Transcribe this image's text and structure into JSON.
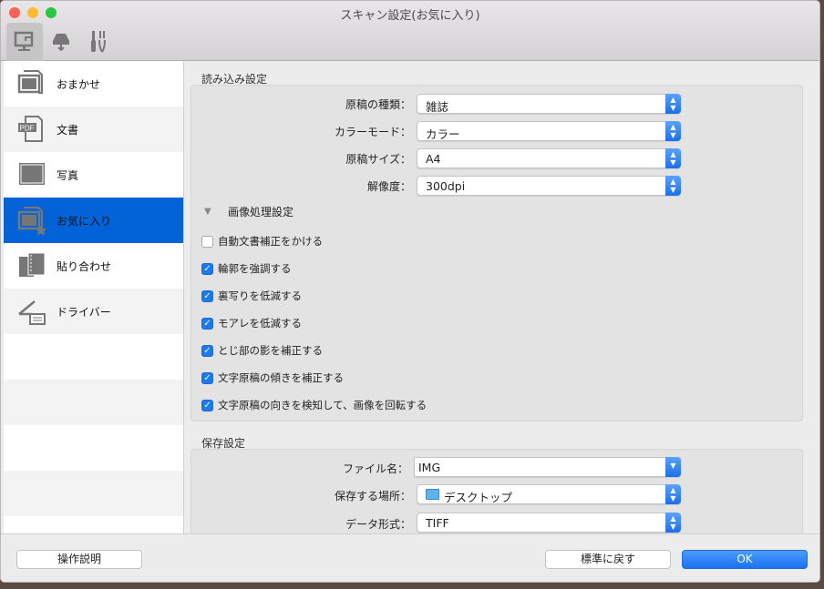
{
  "window": {
    "title": "スキャン設定(お気に入り)"
  },
  "toolbar": {
    "items": [
      "scan-from-computer",
      "scan-from-operation-panel",
      "general-settings"
    ]
  },
  "sidebar": {
    "items": [
      {
        "label": "おまかせ",
        "icon": "auto-scan-icon"
      },
      {
        "label": "文書",
        "icon": "pdf-document-icon"
      },
      {
        "label": "写真",
        "icon": "photo-icon"
      },
      {
        "label": "お気に入り",
        "icon": "favorite-icon",
        "selected": true
      },
      {
        "label": "貼り合わせ",
        "icon": "stitch-icon"
      },
      {
        "label": "ドライバー",
        "icon": "scanner-driver-icon"
      }
    ]
  },
  "scan_settings": {
    "title": "読み込み設定",
    "fields": [
      {
        "label": "原稿の種類：",
        "value": "雑誌"
      },
      {
        "label": "カラーモード：",
        "value": "カラー"
      },
      {
        "label": "原稿サイズ：",
        "value": "A4"
      },
      {
        "label": "解像度：",
        "value": "300dpi"
      }
    ],
    "image_processing": {
      "title": "画像処理設定",
      "expanded": true,
      "options": [
        {
          "label": "自動文書補正をかける",
          "checked": false
        },
        {
          "label": "輪郭を強調する",
          "checked": true
        },
        {
          "label": "裏写りを低減する",
          "checked": true
        },
        {
          "label": "モアレを低減する",
          "checked": true
        },
        {
          "label": "とじ部の影を補正する",
          "checked": true
        },
        {
          "label": "文字原稿の傾きを補正する",
          "checked": true
        },
        {
          "label": "文字原稿の向きを検知して、画像を回転する",
          "checked": true
        }
      ]
    }
  },
  "save_settings": {
    "title": "保存設定",
    "file_name": {
      "label": "ファイル名：",
      "value": "IMG"
    },
    "location": {
      "label": "保存する場所：",
      "value": "デスクトップ"
    },
    "format": {
      "label": "データ形式：",
      "value": "TIFF"
    }
  },
  "footer": {
    "help": "操作説明",
    "defaults": "標準に戻す",
    "ok": "OK"
  },
  "colors": {
    "accent": "#0263d8",
    "button_blue": "#1a72f2"
  }
}
